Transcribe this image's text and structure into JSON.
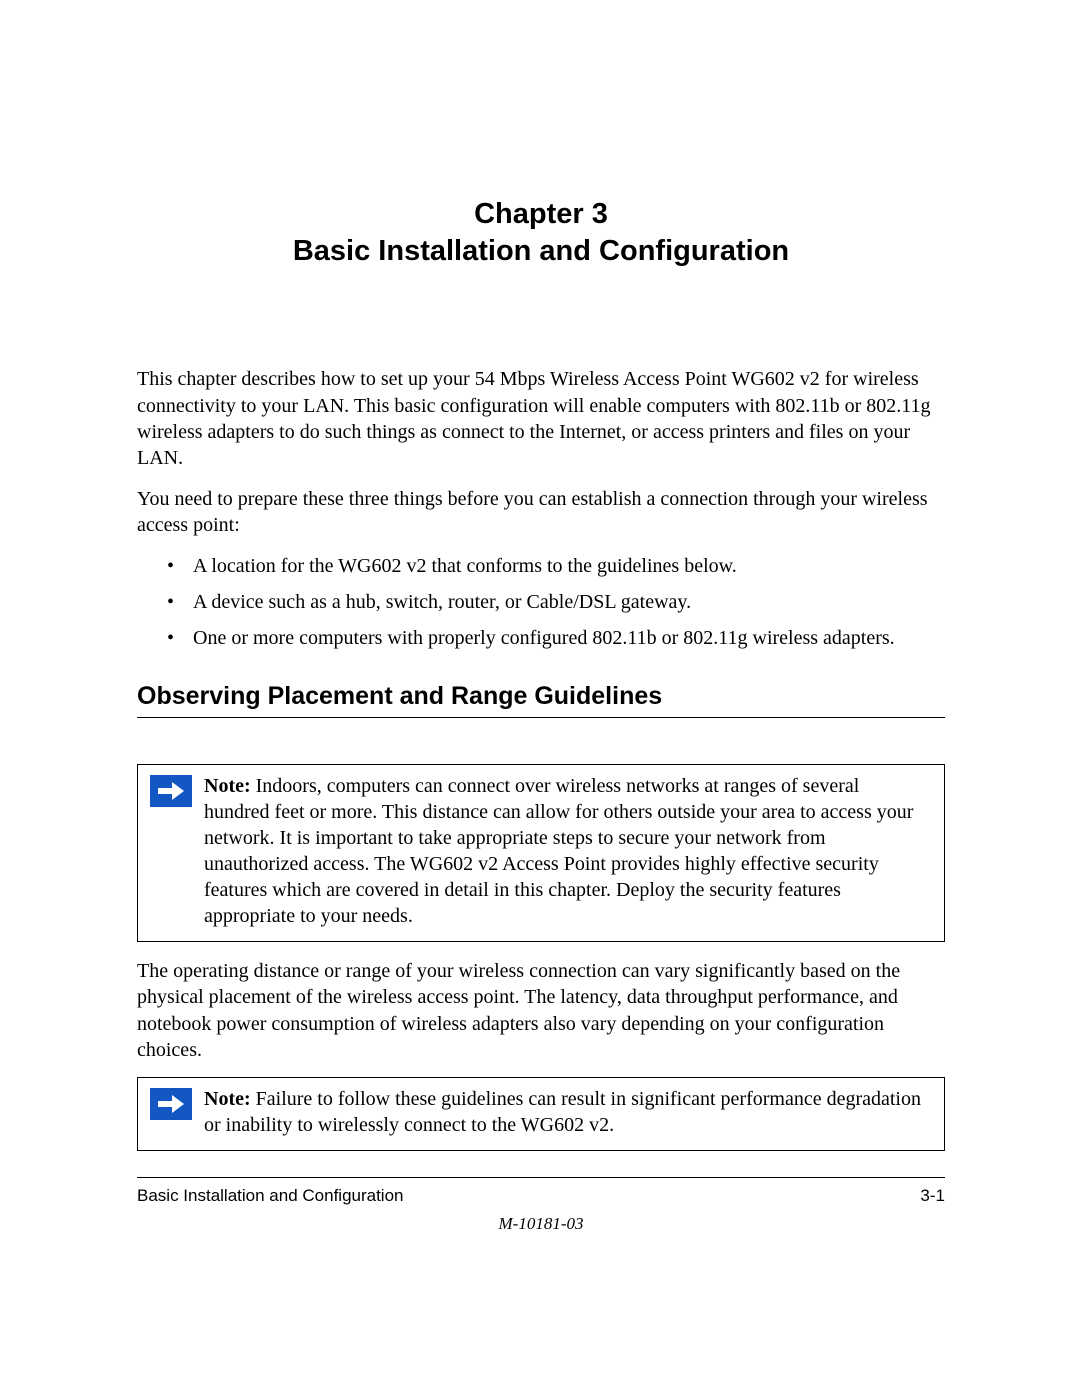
{
  "chapter": {
    "line1": "Chapter 3",
    "line2": "Basic Installation and Configuration"
  },
  "intro": {
    "p1": "This chapter describes how to set up your 54 Mbps Wireless Access Point WG602 v2 for wireless connectivity to your LAN. This basic configuration will enable computers with 802.11b or 802.11g wireless adapters to do such things as connect to the Internet, or access printers and files on your LAN.",
    "p2": "You need to prepare these three things before you can establish a connection through your wireless access point:"
  },
  "bullets": [
    "A location for the WG602 v2 that conforms to the guidelines below.",
    "A device such as a hub, switch, router, or Cable/DSL gateway.",
    "One or more computers with properly configured 802.11b or 802.11g wireless adapters."
  ],
  "section_title": "Observing Placement and Range Guidelines",
  "note1": {
    "label": "Note:",
    "body": " Indoors, computers can connect over wireless networks at ranges of several hundred feet or more. This distance can allow for others outside your area to access your network. It is important to take appropriate steps to secure your network from unauthorized access. The WG602 v2 Access Point provides highly effective security features which are covered in detail in this chapter. Deploy the security features appropriate to your needs."
  },
  "mid_para": "The operating distance or range of your wireless connection can vary significantly based on the physical placement of the wireless access point. The latency, data throughput performance, and notebook power consumption of wireless adapters also vary depending on your configuration choices.",
  "note2": {
    "label": "Note:",
    "body": " Failure to follow these guidelines can result in significant performance degradation or inability to wirelessly connect to the WG602 v2."
  },
  "footer": {
    "left": "Basic Installation and Configuration",
    "right": "3-1",
    "docnum": "M-10181-03"
  }
}
